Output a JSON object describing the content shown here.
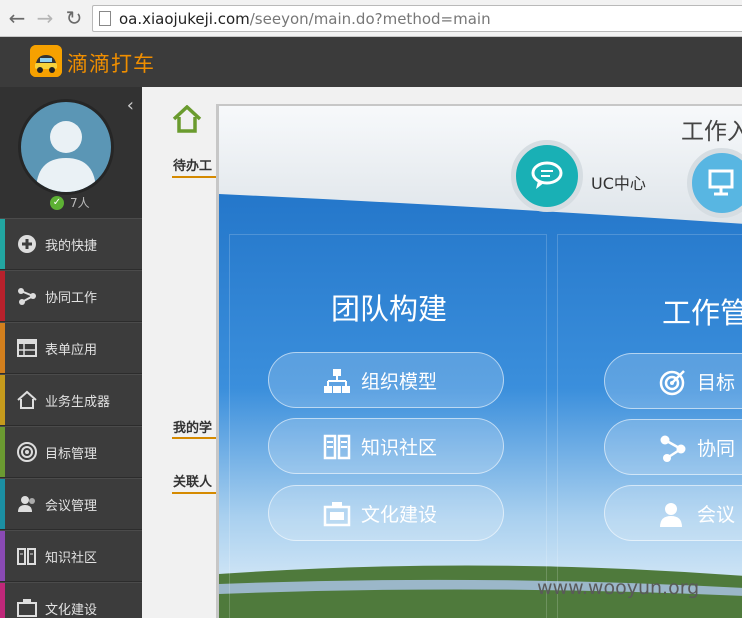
{
  "browser": {
    "url_host": "oa.xiaojukeji.com",
    "url_path": "/seeyon/main.do?method=main"
  },
  "app": {
    "name": "滴滴打车"
  },
  "user": {
    "online_count": "7人"
  },
  "sidebar": {
    "items": [
      {
        "label": "我的快捷",
        "icon": "plus-circle-icon",
        "color": "#22a6a1"
      },
      {
        "label": "协同工作",
        "icon": "share-nodes-icon",
        "color": "#b8212c"
      },
      {
        "label": "表单应用",
        "icon": "form-table-icon",
        "color": "#d27f1d"
      },
      {
        "label": "业务生成器",
        "icon": "house-icon",
        "color": "#c59a1c"
      },
      {
        "label": "目标管理",
        "icon": "target-icon",
        "color": "#6b9a31"
      },
      {
        "label": "会议管理",
        "icon": "people-icon",
        "color": "#1b8fa3"
      },
      {
        "label": "知识社区",
        "icon": "books-icon",
        "color": "#8a4ab4"
      },
      {
        "label": "文化建设",
        "icon": "culture-icon",
        "color": "#c0287a"
      }
    ]
  },
  "main": {
    "sections": [
      "待办工",
      "我的学",
      "关联人"
    ]
  },
  "modal": {
    "title": "工作入",
    "uc_label": "UC中心",
    "left_column": {
      "title": "团队构建",
      "buttons": [
        {
          "label": "组织模型",
          "icon": "org-chart-icon"
        },
        {
          "label": "知识社区",
          "icon": "books-icon"
        },
        {
          "label": "文化建设",
          "icon": "culture-card-icon"
        }
      ]
    },
    "right_column": {
      "title": "工作管",
      "buttons": [
        {
          "label": "目标",
          "icon": "target-icon"
        },
        {
          "label": "协同",
          "icon": "share-nodes-icon"
        },
        {
          "label": "会议",
          "icon": "people-icon"
        }
      ]
    }
  },
  "watermark": "www.wooyun.org"
}
